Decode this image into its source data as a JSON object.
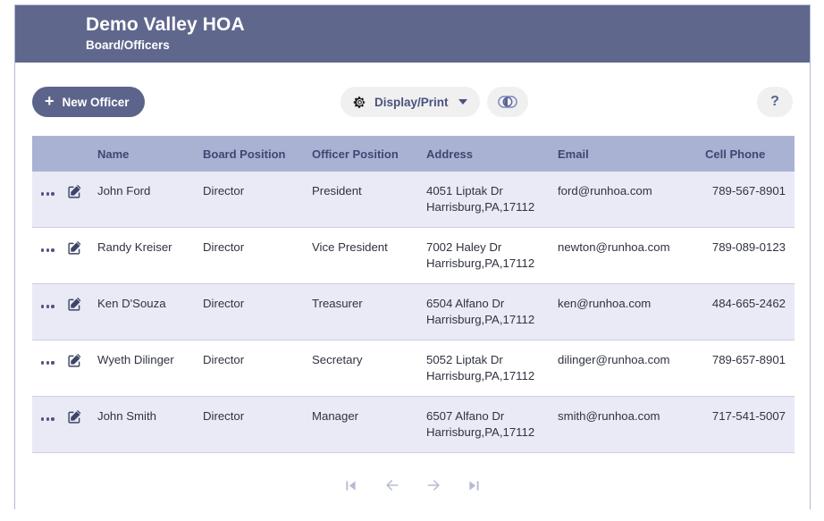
{
  "header": {
    "title": "Demo Valley HOA",
    "subtitle": "Board/Officers",
    "bg_color": "#60678d"
  },
  "toolbar": {
    "new_officer_label": "New Officer",
    "new_officer_plus": "+",
    "display_print_label": "Display/Print",
    "gear_icon": "gear-icon",
    "caret_icon": "chevron-down-icon",
    "toggle_icon": "toggle-switch-icon",
    "help_label": "?",
    "new_officer_color": "#5d648b",
    "pill_bg_color": "#f0f0f0"
  },
  "table": {
    "header_bg_color": "#aab2d4",
    "stripe_color": "#e9eaf5",
    "columns": [
      {
        "key": "actions",
        "label": "",
        "align": "left"
      },
      {
        "key": "name",
        "label": "Name",
        "align": "left"
      },
      {
        "key": "board_position",
        "label": "Board Position",
        "align": "left"
      },
      {
        "key": "officer_position",
        "label": "Officer Position",
        "align": "left"
      },
      {
        "key": "address",
        "label": "Address",
        "align": "left"
      },
      {
        "key": "email",
        "label": "Email",
        "align": "right"
      },
      {
        "key": "cell_phone",
        "label": "Cell Phone",
        "align": "right"
      }
    ],
    "rows": [
      {
        "name": "John Ford",
        "board_position": "Director",
        "officer_position": "President",
        "address_line1": "4051 Liptak Dr",
        "address_line2": "Harrisburg,PA,17112",
        "email": "ford@runhoa.com",
        "cell_phone": "789-567-8901"
      },
      {
        "name": "Randy Kreiser",
        "board_position": "Director",
        "officer_position": "Vice President",
        "address_line1": "7002 Haley Dr",
        "address_line2": "Harrisburg,PA,17112",
        "email": "newton@runhoa.com",
        "cell_phone": "789-089-0123"
      },
      {
        "name": "Ken D'Souza",
        "board_position": "Director",
        "officer_position": "Treasurer",
        "address_line1": "6504 Alfano Dr",
        "address_line2": "Harrisburg,PA,17112",
        "email": "ken@runhoa.com",
        "cell_phone": "484-665-2462"
      },
      {
        "name": "Wyeth Dilinger",
        "board_position": "Director",
        "officer_position": "Secretary",
        "address_line1": "5052 Liptak Dr",
        "address_line2": "Harrisburg,PA,17112",
        "email": "dilinger@runhoa.com",
        "cell_phone": "789-657-8901"
      },
      {
        "name": "John Smith",
        "board_position": "Director",
        "officer_position": "Manager",
        "address_line1": "6507 Alfano Dr",
        "address_line2": "Harrisburg,PA,17112",
        "email": "smith@runhoa.com",
        "cell_phone": "717-541-5007"
      }
    ],
    "row_action_icons": [
      "more-options-icon",
      "edit-icon"
    ]
  },
  "pagination": {
    "first_icon": "first-page-icon",
    "prev_icon": "previous-page-icon",
    "next_icon": "next-page-icon",
    "last_icon": "last-page-icon",
    "icon_color": "#b6bbd4"
  }
}
